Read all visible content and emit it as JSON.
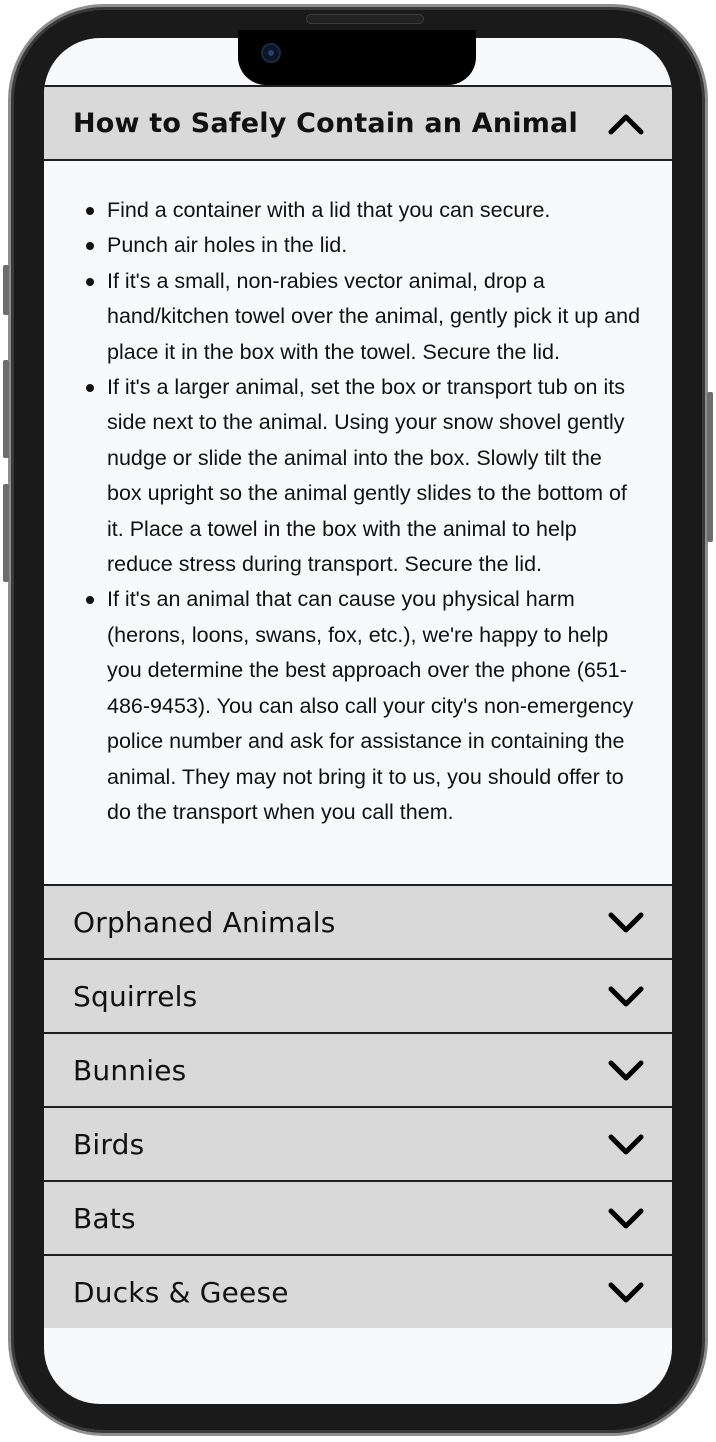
{
  "accordion": {
    "open_section": {
      "title": "How to Safely Contain an Animal",
      "items": [
        "Find a container with a lid that you can secure.",
        "Punch air holes in the lid.",
        "If it's a small, non-rabies vector animal, drop a hand/kitchen towel over the animal, gently pick it up and place it in the box with the towel. Secure the lid.",
        "If it's a larger animal, set the box or transport tub on its side next to the animal. Using your snow shovel gently nudge or slide the animal into the box. Slowly tilt the box upright so the animal gently slides to the bottom of it. Place a towel in the box with the animal to help reduce stress during transport. Secure the lid.",
        "If it's an animal that can cause you physical harm (herons, loons, swans, fox, etc.), we're happy to help you determine the best approach over the phone (651-486-9453). You can also call your city's non-emergency police number and ask for assistance in containing the animal. They may not bring it to us, you should offer to do the transport when you call them."
      ]
    },
    "sections": [
      {
        "title": "Orphaned Animals"
      },
      {
        "title": "Squirrels"
      },
      {
        "title": "Bunnies"
      },
      {
        "title": "Birds"
      },
      {
        "title": "Bats"
      },
      {
        "title": "Ducks & Geese"
      }
    ]
  },
  "icons": {
    "open": "chevron-up-icon",
    "closed": "chevron-down-icon"
  },
  "colors": {
    "header_bg": "#d9d9d9",
    "body_bg": "#f8f9fb",
    "text": "#111111",
    "divider": "#1f1f1f"
  }
}
